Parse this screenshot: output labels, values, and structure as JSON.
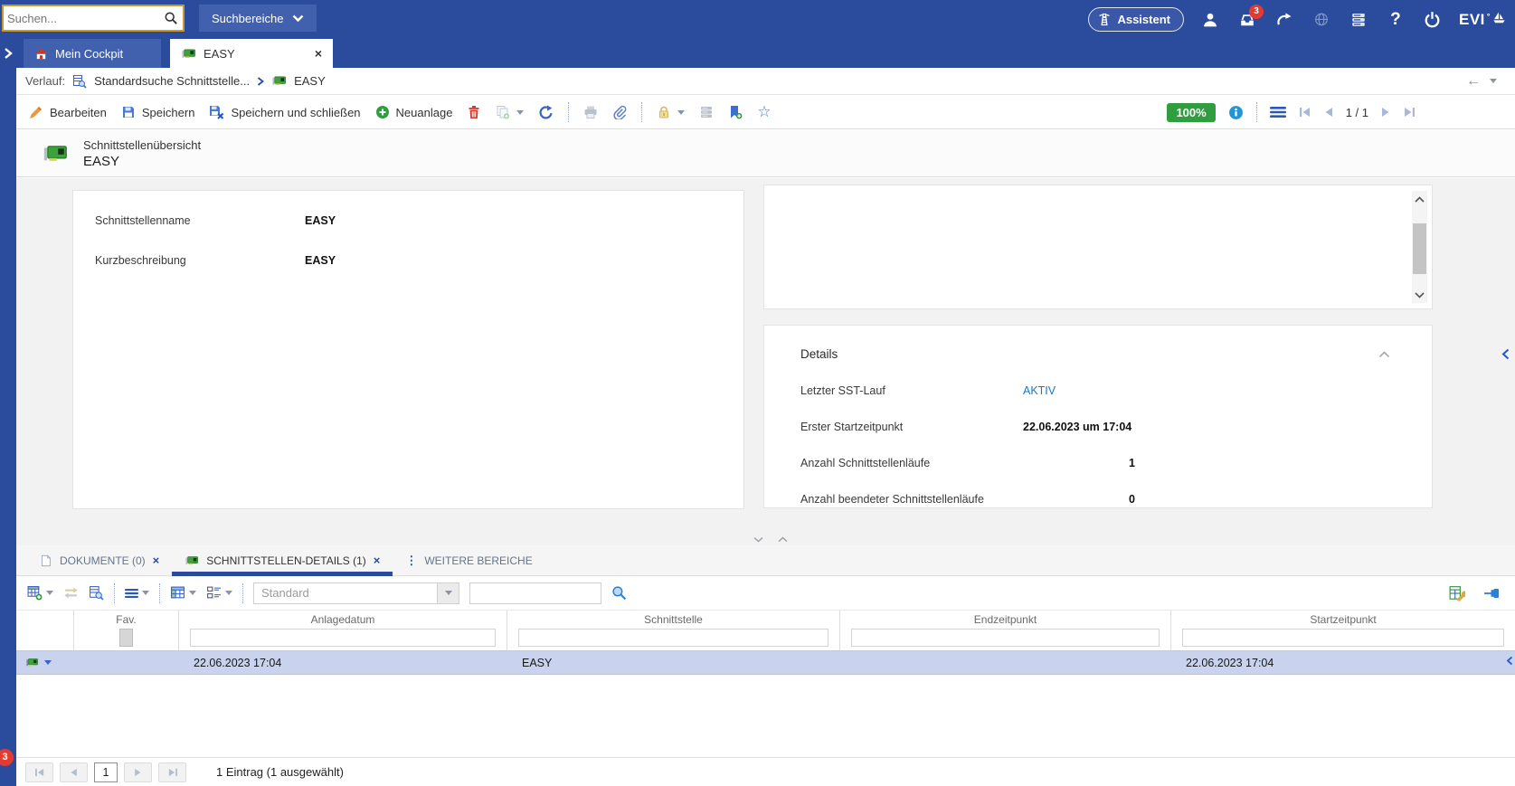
{
  "topbar": {
    "search": {
      "placeholder": "Suchen..."
    },
    "scope_button": "Suchbereiche",
    "assistant": "Assistent",
    "inbox_badge": "3",
    "help": "?",
    "brand": "EVI"
  },
  "tabbar": {
    "tabs": [
      {
        "label": "Mein Cockpit"
      },
      {
        "label": "EASY"
      }
    ]
  },
  "breadcrumb": {
    "label": "Verlauf:",
    "items": [
      {
        "label": "Standardsuche Schnittstelle..."
      },
      {
        "label": "EASY"
      }
    ]
  },
  "toolbar": {
    "buttons": {
      "edit": "Bearbeiten",
      "save": "Speichern",
      "save_and_close": "Speichern und schließen",
      "create": "Neuanlage"
    },
    "zoom_badge": "100%",
    "pager": "1 / 1"
  },
  "page_header": {
    "category": "Schnittstellenübersicht",
    "title": "EASY"
  },
  "overview_form": {
    "fields": [
      {
        "label": "Schnittstellenname",
        "value": "EASY"
      },
      {
        "label": "Kurzbeschreibung",
        "value": "EASY"
      }
    ]
  },
  "details_panel": {
    "title": "Details",
    "rows": [
      {
        "label": "Letzter SST-Lauf",
        "value": "AKTIV"
      },
      {
        "label": "Erster Startzeitpunkt",
        "value": "22.06.2023 um 17:04"
      },
      {
        "label": "Anzahl Schnittstellenläufe",
        "value": "1"
      },
      {
        "label": "Anzahl beendeter Schnittstellenläufe",
        "value": "0"
      }
    ]
  },
  "section_tabs": [
    {
      "label": "DOKUMENTE (0)"
    },
    {
      "label": "SCHNITTSTELLEN-DETAILS (1)"
    },
    {
      "label": "WEITERE BEREICHE"
    }
  ],
  "grid": {
    "view_select": "Standard",
    "columns": {
      "fav": "Fav.",
      "anlagedatum": "Anlagedatum",
      "schnittstelle": "Schnittstelle",
      "endzeitpunkt": "Endzeitpunkt",
      "startzeitpunkt": "Startzeitpunkt"
    },
    "rows": [
      {
        "anlagedatum": "22.06.2023 17:04",
        "schnittstelle": "EASY",
        "endzeitpunkt": "",
        "startzeitpunkt": "22.06.2023 17:04"
      }
    ],
    "pager": {
      "page": "1",
      "summary": "1 Eintrag (1 ausgewählt)"
    },
    "badge": "3"
  },
  "icons": {
    "close": "×",
    "star": "☆",
    "back": "←",
    "dots_vertical": "⋮"
  },
  "colors": {
    "topbar_blue": "#2b4b9c",
    "accent_blue": "#3b62c4",
    "zoom_badge_green": "#2f9e3f",
    "link_blue": "#1976d2",
    "selected_row": "#c9d3ee",
    "alert_red": "#e23c32",
    "interface_icon_green": "#3da23d"
  }
}
